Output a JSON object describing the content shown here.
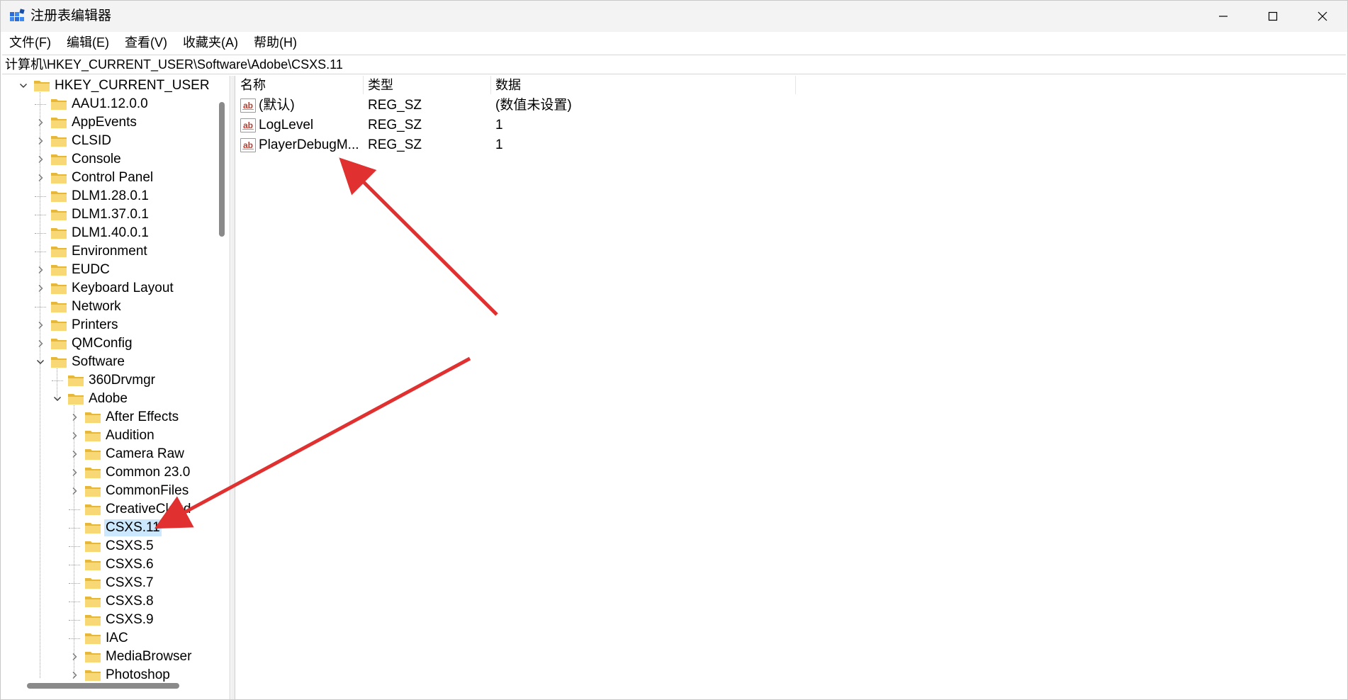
{
  "window": {
    "title": "注册表编辑器"
  },
  "menu": [
    {
      "label": "文件(F)"
    },
    {
      "label": "编辑(E)"
    },
    {
      "label": "查看(V)"
    },
    {
      "label": "收藏夹(A)"
    },
    {
      "label": "帮助(H)"
    }
  ],
  "address": "计算机\\HKEY_CURRENT_USER\\Software\\Adobe\\CSXS.11",
  "tree": {
    "root": "HKEY_CURRENT_USER",
    "items": [
      {
        "label": "AAU1.12.0.0"
      },
      {
        "label": "AppEvents"
      },
      {
        "label": "CLSID"
      },
      {
        "label": "Console"
      },
      {
        "label": "Control Panel"
      },
      {
        "label": "DLM1.28.0.1"
      },
      {
        "label": "DLM1.37.0.1"
      },
      {
        "label": "DLM1.40.0.1"
      },
      {
        "label": "Environment"
      },
      {
        "label": "EUDC"
      },
      {
        "label": "Keyboard Layout"
      },
      {
        "label": "Network"
      },
      {
        "label": "Printers"
      },
      {
        "label": "QMConfig"
      },
      {
        "label": "Software"
      },
      {
        "label": "360Drvmgr"
      },
      {
        "label": "Adobe"
      },
      {
        "label": "After Effects"
      },
      {
        "label": "Audition"
      },
      {
        "label": "Camera Raw"
      },
      {
        "label": "Common 23.0"
      },
      {
        "label": "CommonFiles"
      },
      {
        "label": "CreativeCloud"
      },
      {
        "label": "CSXS.11"
      },
      {
        "label": "CSXS.5"
      },
      {
        "label": "CSXS.6"
      },
      {
        "label": "CSXS.7"
      },
      {
        "label": "CSXS.8"
      },
      {
        "label": "CSXS.9"
      },
      {
        "label": "IAC"
      },
      {
        "label": "MediaBrowser"
      },
      {
        "label": "Photoshop"
      }
    ]
  },
  "values": {
    "columns": [
      "名称",
      "类型",
      "数据"
    ],
    "rows": [
      {
        "name": "(默认)",
        "type": "REG_SZ",
        "data": "(数值未设置)",
        "icon": "ab"
      },
      {
        "name": "LogLevel",
        "type": "REG_SZ",
        "data": "1",
        "icon": "ab"
      },
      {
        "name": "PlayerDebugM...",
        "type": "REG_SZ",
        "data": "1",
        "icon": "ab"
      }
    ]
  },
  "colors": {
    "arrow": "#e03030",
    "selection": "#cce8ff",
    "folder": "#f8d775"
  }
}
